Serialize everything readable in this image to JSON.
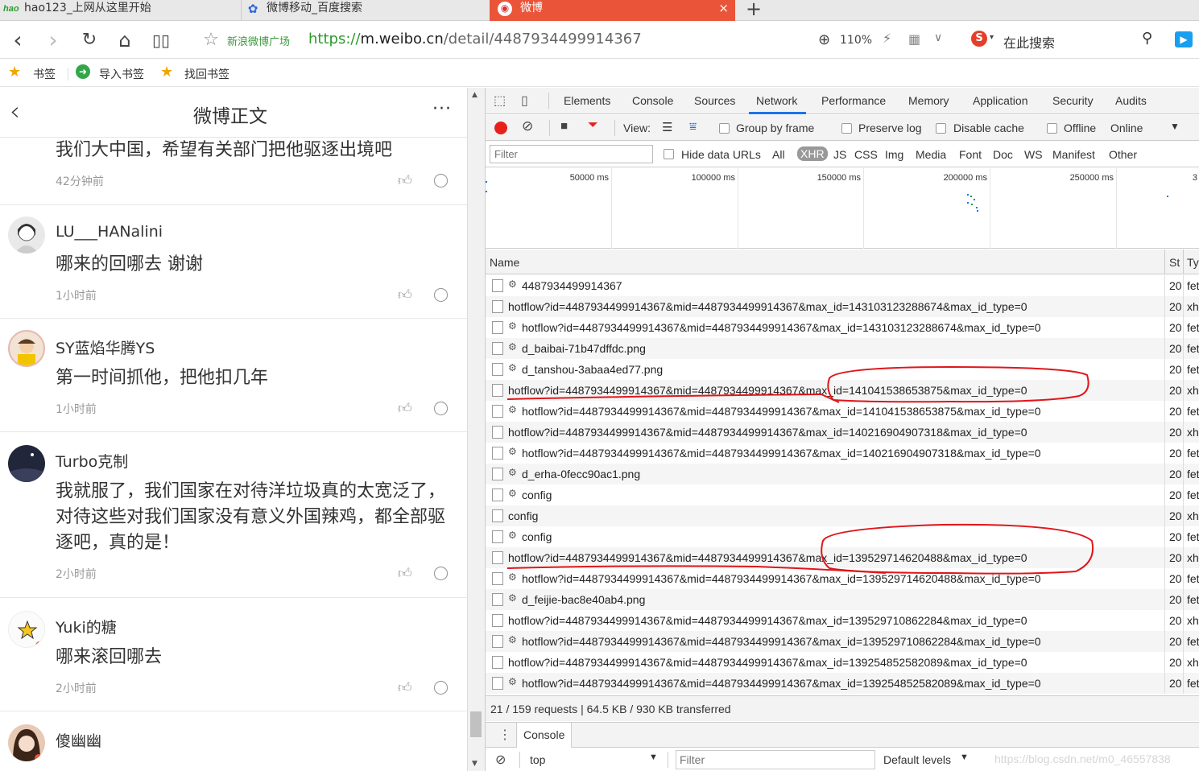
{
  "tabs": [
    {
      "label": "hao123_上网从这里开始",
      "favicon": "hao"
    },
    {
      "label": "微博移动_百度搜索",
      "favicon": "baidu-paw"
    },
    {
      "label": "微博",
      "favicon": "weibo-eye",
      "active": true
    }
  ],
  "tab_close": "×",
  "new_tab": "+",
  "address": {
    "site_label": "新浪微博广场",
    "url_scheme": "https://",
    "url_host": "m.weibo.cn",
    "url_path": "/detail/4487934499914367",
    "zoom": "110%",
    "search_placeholder": "在此搜索"
  },
  "bookmarks": [
    {
      "label": "书签",
      "icon": "star-icon"
    },
    {
      "label": "导入书签",
      "icon": "import-icon"
    },
    {
      "label": "找回书签",
      "icon": "star-icon"
    }
  ],
  "weibo": {
    "title": "微博正文",
    "more": "···",
    "first_comment": {
      "text": "我们大中国，希望有关部门把他驱逐出境吧",
      "time": "42分钟前"
    },
    "comments": [
      {
        "name": "LU___HANalini",
        "text": "哪来的回哪去 谢谢",
        "time": "1小时前"
      },
      {
        "name": "SY蓝焰华腾YS",
        "text": "第一时间抓他，把他扣几年",
        "time": "1小时前"
      },
      {
        "name": "Turbo克制",
        "text": "我就服了，我们国家在对待洋垃圾真的太宽泛了，对待这些对我们国家没有意义外国辣鸡，都全部驱逐吧，真的是！",
        "time": "2小时前"
      },
      {
        "name": "Yuki的糖",
        "text": "哪来滚回哪去",
        "time": "2小时前"
      },
      {
        "name": "傻幽幽",
        "text": "",
        "time": ""
      }
    ]
  },
  "devtools": {
    "tabs": [
      "Elements",
      "Console",
      "Sources",
      "Network",
      "Performance",
      "Memory",
      "Application",
      "Security",
      "Audits"
    ],
    "active_tab": "Network",
    "toolbar": {
      "view_label": "View:",
      "group_by_frame": "Group by frame",
      "preserve_log": "Preserve log",
      "disable_cache": "Disable cache",
      "offline": "Offline",
      "throttle": "Online"
    },
    "filter": {
      "placeholder": "Filter",
      "hide_data_urls": "Hide data URLs",
      "types": [
        "All",
        "XHR",
        "JS",
        "CSS",
        "Img",
        "Media",
        "Font",
        "Doc",
        "WS",
        "Manifest",
        "Other"
      ],
      "active_type": "XHR"
    },
    "overview_ticks": [
      "50000 ms",
      "100000 ms",
      "150000 ms",
      "200000 ms",
      "250000 ms",
      "3"
    ],
    "columns": {
      "name": "Name",
      "status": "St",
      "type": "Ty"
    },
    "requests": [
      {
        "name": "4487934499914367",
        "gear": true,
        "status": "20",
        "type": "fet"
      },
      {
        "name": "hotflow?id=4487934499914367&mid=4487934499914367&max_id=143103123288674&max_id_type=0",
        "gear": false,
        "status": "20",
        "type": "xhr"
      },
      {
        "name": "hotflow?id=4487934499914367&mid=4487934499914367&max_id=143103123288674&max_id_type=0",
        "gear": true,
        "status": "20",
        "type": "fet"
      },
      {
        "name": "d_baibai-71b47dffdc.png",
        "gear": true,
        "status": "20",
        "type": "fet"
      },
      {
        "name": "d_tanshou-3abaa4ed77.png",
        "gear": true,
        "status": "20",
        "type": "fet"
      },
      {
        "name": "hotflow?id=4487934499914367&mid=4487934499914367&max_id=141041538653875&max_id_type=0",
        "gear": false,
        "status": "20",
        "type": "xhr"
      },
      {
        "name": "hotflow?id=4487934499914367&mid=4487934499914367&max_id=141041538653875&max_id_type=0",
        "gear": true,
        "status": "20",
        "type": "fet"
      },
      {
        "name": "hotflow?id=4487934499914367&mid=4487934499914367&max_id=140216904907318&max_id_type=0",
        "gear": false,
        "status": "20",
        "type": "xhr"
      },
      {
        "name": "hotflow?id=4487934499914367&mid=4487934499914367&max_id=140216904907318&max_id_type=0",
        "gear": true,
        "status": "20",
        "type": "fet"
      },
      {
        "name": "d_erha-0fecc90ac1.png",
        "gear": true,
        "status": "20",
        "type": "fet"
      },
      {
        "name": "config",
        "gear": true,
        "status": "20",
        "type": "fet"
      },
      {
        "name": "config",
        "gear": false,
        "status": "20",
        "type": "xhr"
      },
      {
        "name": "config",
        "gear": true,
        "status": "20",
        "type": "fet"
      },
      {
        "name": "hotflow?id=4487934499914367&mid=4487934499914367&max_id=139529714620488&max_id_type=0",
        "gear": false,
        "status": "20",
        "type": "xhr"
      },
      {
        "name": "hotflow?id=4487934499914367&mid=4487934499914367&max_id=139529714620488&max_id_type=0",
        "gear": true,
        "status": "20",
        "type": "fet"
      },
      {
        "name": "d_feijie-bac8e40ab4.png",
        "gear": true,
        "status": "20",
        "type": "fet"
      },
      {
        "name": "hotflow?id=4487934499914367&mid=4487934499914367&max_id=139529710862284&max_id_type=0",
        "gear": false,
        "status": "20",
        "type": "xhr"
      },
      {
        "name": "hotflow?id=4487934499914367&mid=4487934499914367&max_id=139529710862284&max_id_type=0",
        "gear": true,
        "status": "20",
        "type": "fet"
      },
      {
        "name": "hotflow?id=4487934499914367&mid=4487934499914367&max_id=139254852582089&max_id_type=0",
        "gear": false,
        "status": "20",
        "type": "xhr"
      },
      {
        "name": "hotflow?id=4487934499914367&mid=4487934499914367&max_id=139254852582089&max_id_type=0",
        "gear": true,
        "status": "20",
        "type": "fet"
      }
    ],
    "summary": "21 / 159 requests  |  64.5 KB / 930 KB transferred",
    "drawer": {
      "tab": "Console",
      "context": "top",
      "filter_placeholder": "Filter",
      "levels": "Default levels"
    }
  },
  "watermark": "https://blog.csdn.net/m0_46557838",
  "colors": {
    "accent": "#1a73e8",
    "weibo_tab": "#ea5539",
    "record": "#e8201c",
    "annotation": "#e0161b"
  }
}
